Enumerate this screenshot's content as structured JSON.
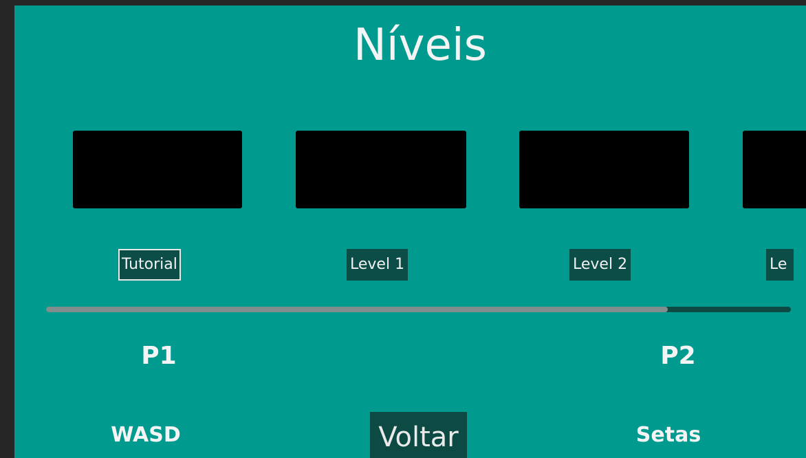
{
  "screen": {
    "title": "Níveis"
  },
  "levels": [
    {
      "label": "Tutorial",
      "selected": true
    },
    {
      "label": "Level 1",
      "selected": false
    },
    {
      "label": "Level 2",
      "selected": false
    },
    {
      "label": "Le",
      "selected": false
    }
  ],
  "scrollbar": {
    "fraction_visible": 0.835,
    "position": 0
  },
  "players": {
    "p1": {
      "label": "P1",
      "controls": "WASD"
    },
    "p2": {
      "label": "P2",
      "controls": "Setas"
    }
  },
  "back_button": {
    "label": "Voltar"
  },
  "colors": {
    "background": "#009b8e",
    "button_dark": "#0d4d47",
    "thumbnail": "#000000",
    "text": "#f4f4f4",
    "frame": "#262626"
  }
}
